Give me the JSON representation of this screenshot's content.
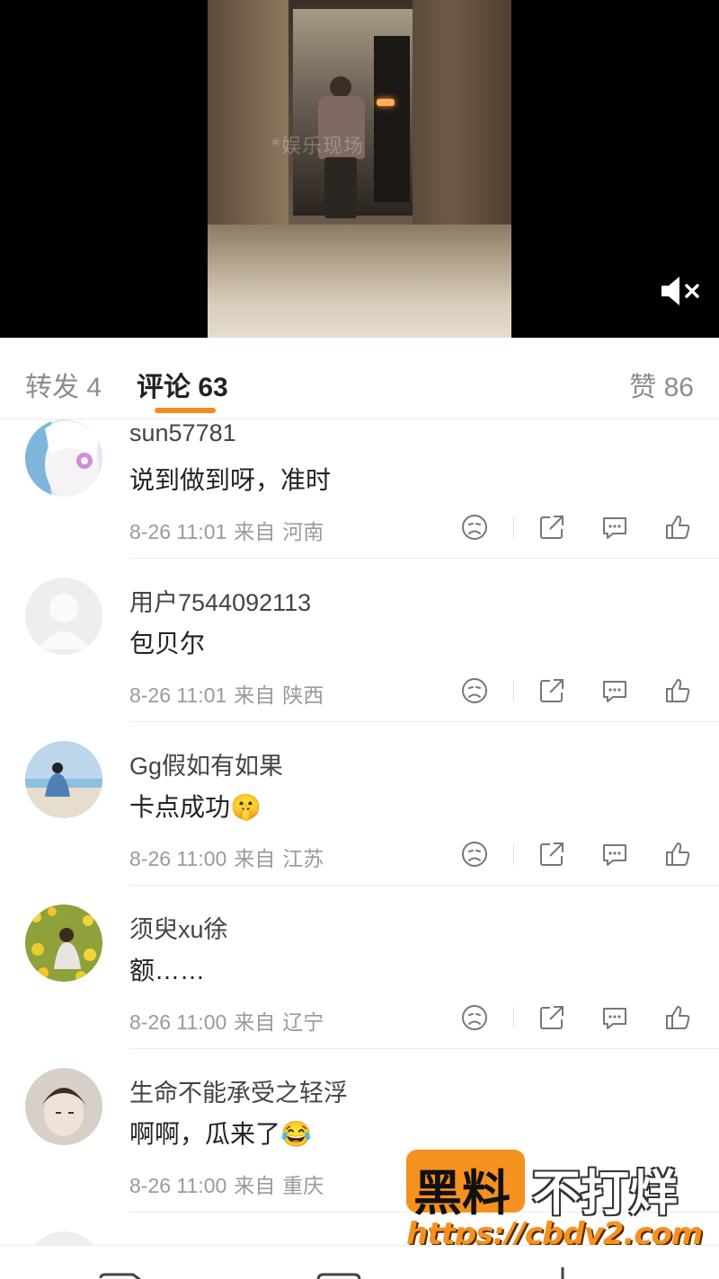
{
  "video": {
    "watermark_text": "*娱乐现场",
    "mute_icon": "speaker-muted-icon"
  },
  "tabs": {
    "repost": "转发 4",
    "comments": "评论 63",
    "likes": "赞 86",
    "accent": "#f58a1f"
  },
  "comments": [
    {
      "username": "sun57781",
      "text": "说到做到呀，准时",
      "date": "8-26 11:01",
      "from": "来自",
      "location": "河南"
    },
    {
      "username": "用户7544092113",
      "text": "包贝尔",
      "date": "8-26 11:01",
      "from": "来自",
      "location": "陕西"
    },
    {
      "username": "Gg假如有如果",
      "text": "卡点成功🤫",
      "date": "8-26 11:00",
      "from": "来自",
      "location": "江苏"
    },
    {
      "username": "须臾xu徐",
      "text": "额……",
      "date": "8-26 11:00",
      "from": "来自",
      "location": "辽宁"
    },
    {
      "username": "生命不能承受之轻浮",
      "text": "啊啊，瓜来了😂",
      "date": "8-26 11:00",
      "from": "来自",
      "location": "重庆"
    }
  ],
  "watermark": {
    "brand_a": "黑料",
    "brand_b": "不打烊",
    "url": "https://cbdy2.com"
  }
}
